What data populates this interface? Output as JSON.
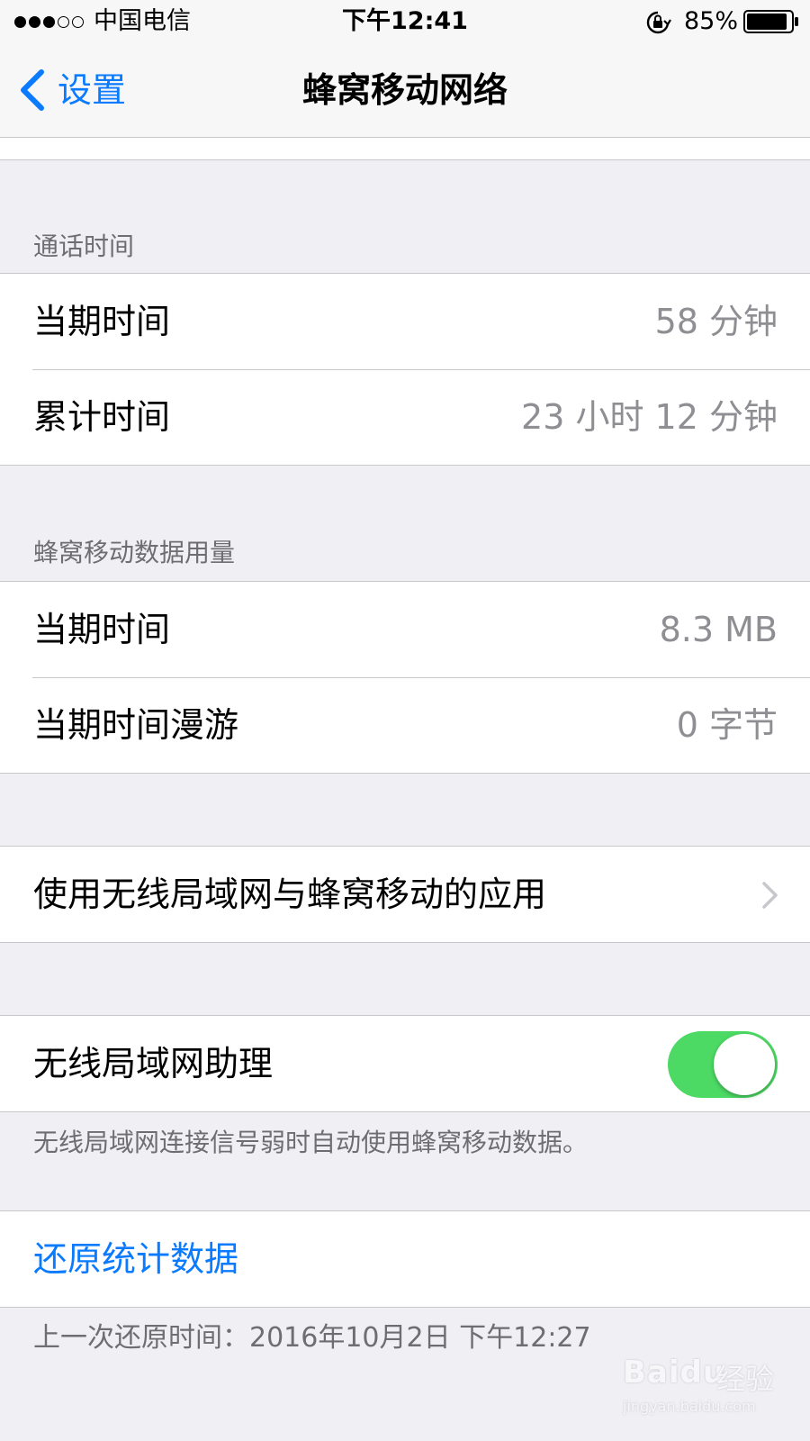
{
  "status_bar": {
    "carrier": "中国电信",
    "time": "下午12:41",
    "battery": "85%",
    "signal_bars_filled": 3,
    "signal_bars_total": 5
  },
  "nav": {
    "back_label": "设置",
    "title": "蜂窝移动网络"
  },
  "call_time": {
    "header": "通话时间",
    "rows": [
      {
        "label": "当期时间",
        "value": "58 分钟"
      },
      {
        "label": "累计时间",
        "value": "23 小时 12 分钟"
      }
    ]
  },
  "cellular_data": {
    "header": "蜂窝移动数据用量",
    "rows": [
      {
        "label": "当期时间",
        "value": "8.3 MB"
      },
      {
        "label": "当期时间漫游",
        "value": "0 字节"
      }
    ]
  },
  "apps_row": {
    "label": "使用无线局域网与蜂窝移动的应用"
  },
  "wifi_assist": {
    "label": "无线局域网助理",
    "enabled": true,
    "footer": "无线局域网连接信号弱时自动使用蜂窝移动数据。"
  },
  "reset": {
    "label": "还原统计数据",
    "last_reset": "上一次还原时间：2016年10月2日 下午12:27"
  },
  "watermark": {
    "brand": "Baidu",
    "brand_cn": "经验",
    "url": "jingyan.baidu.com"
  },
  "colors": {
    "accent": "#0a7aff",
    "toggle_on": "#4cd964",
    "background": "#efeff4"
  }
}
